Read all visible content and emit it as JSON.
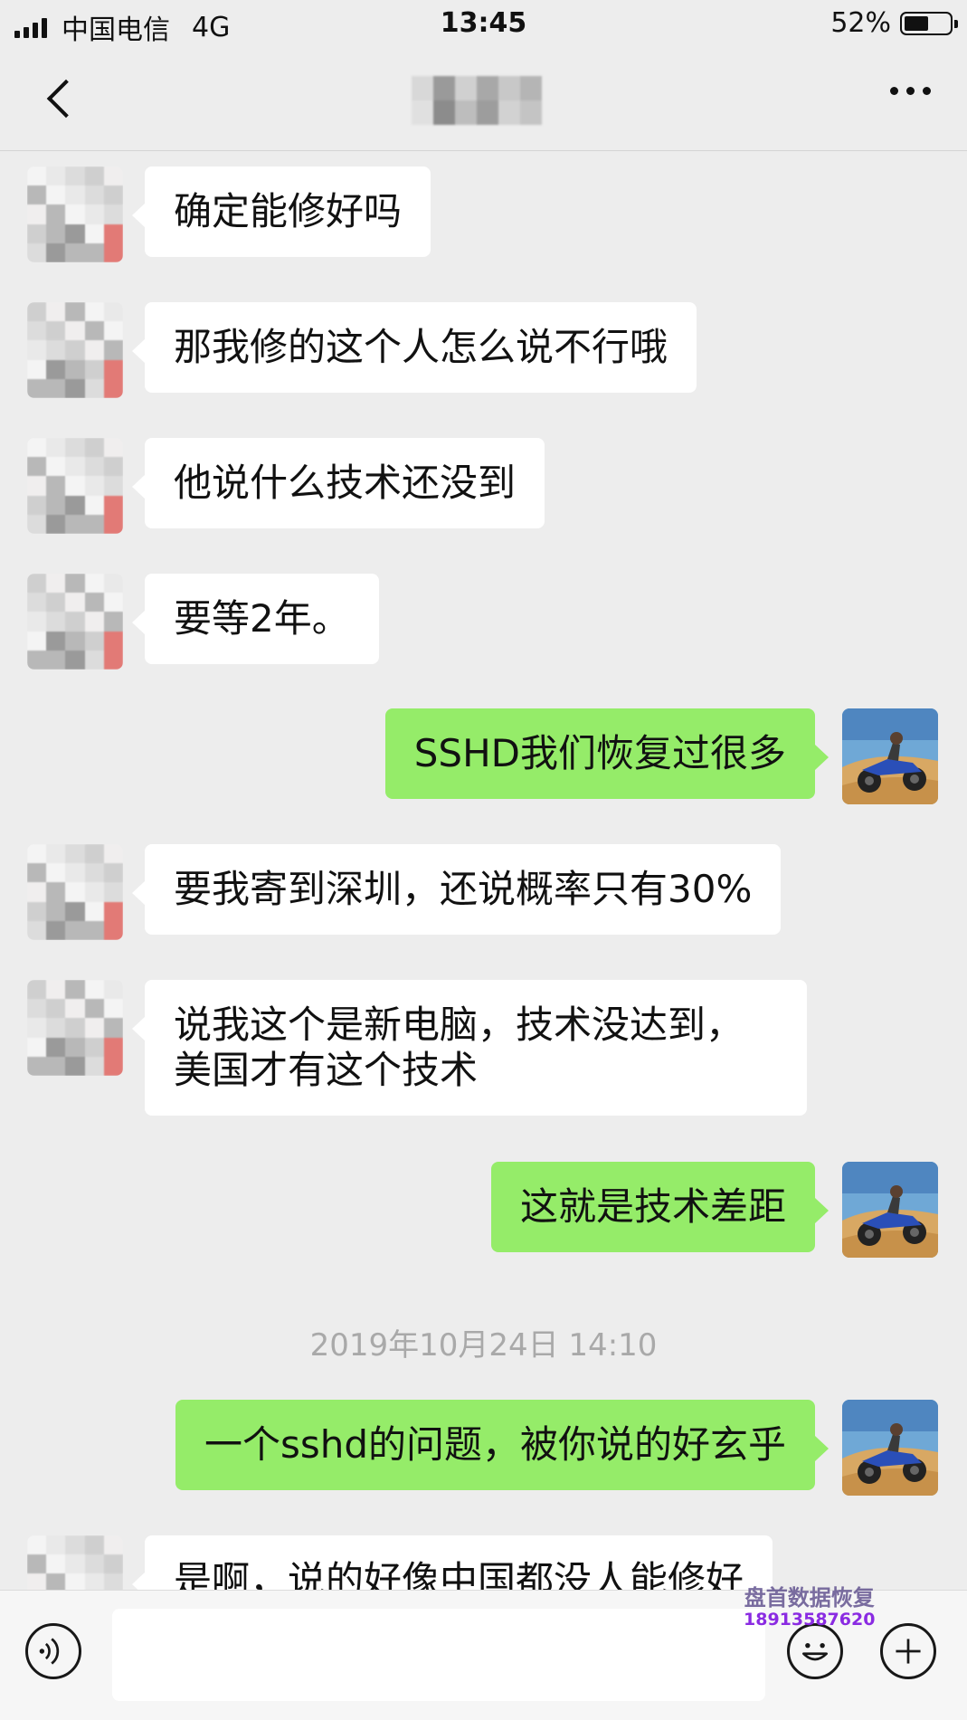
{
  "status_bar": {
    "carrier": "中国电信",
    "network": "4G",
    "time": "13:45",
    "battery": "52%"
  },
  "nav": {
    "back_icon": "chevron-left-icon",
    "title": "",
    "more_icon": "ellipsis-icon"
  },
  "messages": [
    {
      "side": "in",
      "text": "确定能修好吗"
    },
    {
      "side": "in",
      "text": "那我修的这个人怎么说不行哦"
    },
    {
      "side": "in",
      "text": "他说什么技术还没到"
    },
    {
      "side": "in",
      "text": "要等2年。"
    },
    {
      "side": "out",
      "text": "SSHD我们恢复过很多"
    },
    {
      "side": "in",
      "text": "要我寄到深圳，还说概率只有30%"
    },
    {
      "side": "in",
      "lines": [
        "说我这个是新电脑，技术没达到，",
        "美国才有这个技术"
      ]
    },
    {
      "side": "out",
      "text": "这就是技术差距"
    },
    {
      "side": "out",
      "text": "一个sshd的问题，被你说的好玄乎"
    },
    {
      "side": "in",
      "text": "是啊，说的好像中国都没人能修好"
    }
  ],
  "timestamp": "2019年10月24日 14:10",
  "input_bar": {
    "voice_icon": "voice-icon",
    "emoji_icon": "emoji-icon",
    "plus_icon": "plus-icon",
    "input_value": ""
  },
  "watermark": {
    "line1": "盘首数据恢复",
    "line2": "18913587620"
  },
  "colors": {
    "background": "#ededed",
    "outgoing_bubble": "#95ec69",
    "incoming_bubble": "#ffffff",
    "timestamp": "#a9a9a9"
  }
}
